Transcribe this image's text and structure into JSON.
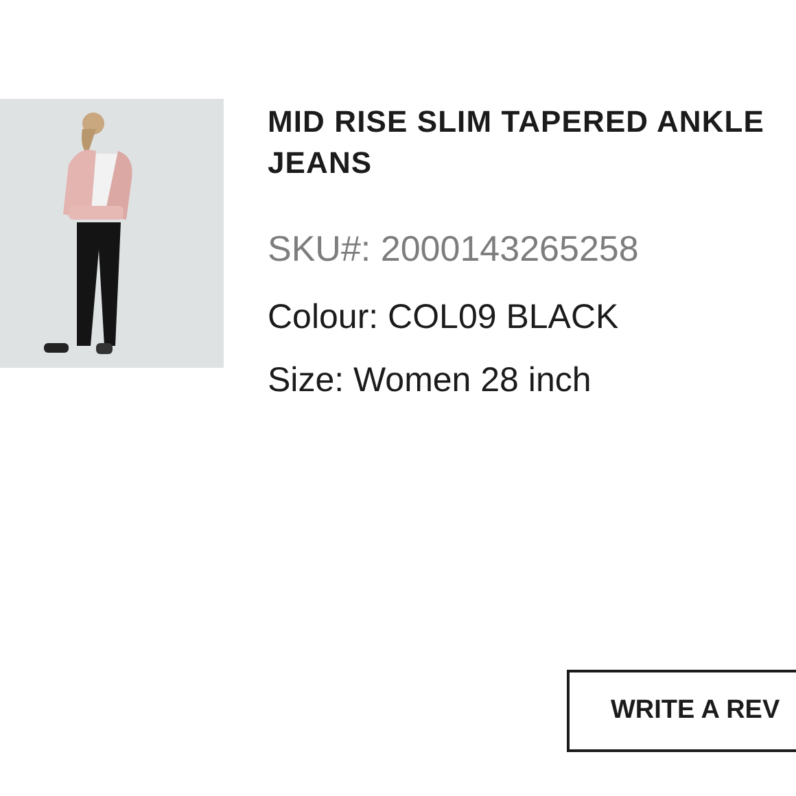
{
  "product": {
    "title": "MID RISE SLIM TAPERED ANKLE JEANS",
    "sku": "SKU#: 2000143265258",
    "colour": "Colour: COL09 BLACK",
    "size": "Size: Women 28 inch"
  },
  "review_button": {
    "label": "WRITE A REV"
  }
}
